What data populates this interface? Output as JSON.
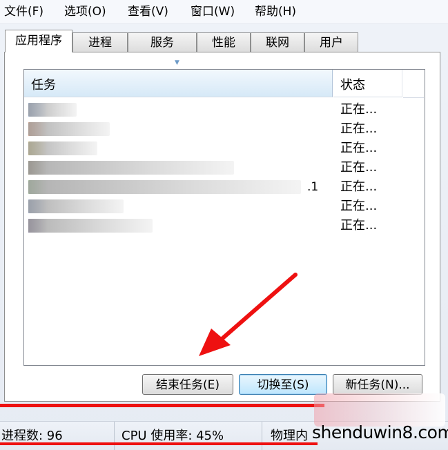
{
  "menu": [
    {
      "label": "文件(F)"
    },
    {
      "label": "选项(O)"
    },
    {
      "label": "查看(V)"
    },
    {
      "label": "窗口(W)"
    },
    {
      "label": "帮助(H)"
    }
  ],
  "tabs": [
    {
      "label": "应用程序",
      "active": true
    },
    {
      "label": "进程",
      "active": false
    },
    {
      "label": "服务",
      "active": false
    },
    {
      "label": "性能",
      "active": false
    },
    {
      "label": "联网",
      "active": false
    },
    {
      "label": "用户",
      "active": false
    }
  ],
  "task_list": {
    "columns": {
      "task": "任务",
      "status": "状态"
    },
    "rows": [
      {
        "status": "正在...",
        "icon_color": "#a9c4f0",
        "suffix": ""
      },
      {
        "status": "正在...",
        "icon_color": "#f4b79a",
        "suffix": ""
      },
      {
        "status": "正在...",
        "icon_color": "#e9d98c",
        "suffix": ""
      },
      {
        "status": "正在...",
        "icon_color": "#a99e86",
        "suffix": ""
      },
      {
        "status": "正在...",
        "icon_color": "#b9dcae",
        "suffix": ".1"
      },
      {
        "status": "正在...",
        "icon_color": "#a9bde6",
        "suffix": ""
      },
      {
        "status": "正在...",
        "icon_color": "#9a8fb2",
        "suffix": ""
      }
    ]
  },
  "buttons": {
    "end_task": "结束任务(E)",
    "switch_to": "切换至(S)",
    "new_task": "新任务(N)..."
  },
  "statusbar": {
    "processes": "进程数: 96",
    "cpu": "CPU 使用率: 45%",
    "memory": "物理内"
  },
  "watermark": "shenduwin8.com",
  "colors": {
    "annotation_red": "#ee1111",
    "window_bg": "#eef2f8"
  }
}
